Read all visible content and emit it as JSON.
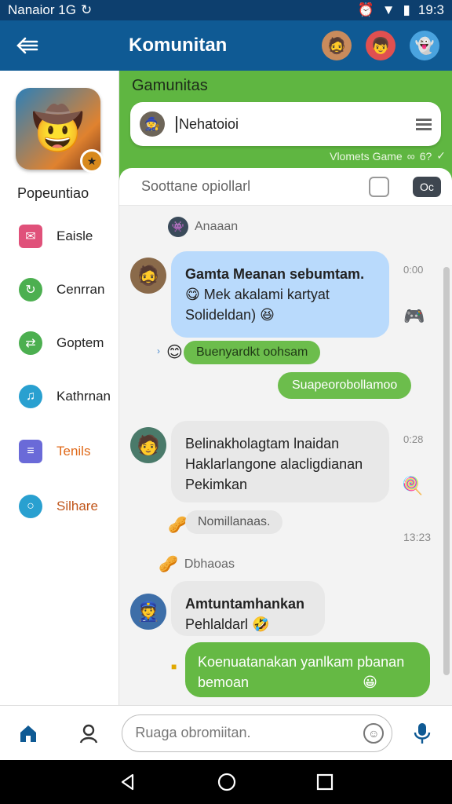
{
  "status_bar": {
    "carrier": "Nanaior 1G",
    "time": "19:3"
  },
  "app_bar": {
    "title": "Komunitan"
  },
  "sidebar": {
    "title": "Popeuntiao",
    "items": [
      {
        "label": "Eaisle",
        "icon": "bookmark-icon",
        "color": "#e0517a"
      },
      {
        "label": "Cenrran",
        "icon": "refresh-icon",
        "color": "#4caf50"
      },
      {
        "label": "Goptem",
        "icon": "sync-icon",
        "color": "#4caf50"
      },
      {
        "label": "Kathrnan",
        "icon": "music-icon",
        "color": "#29a0d0"
      },
      {
        "label": "Tenils",
        "icon": "list-icon",
        "color": "#6a6ad8",
        "label_color": "#e06a1a"
      },
      {
        "label": "Silhare",
        "icon": "chat-icon",
        "color": "#29a0d0",
        "label_color": "#c0551a"
      }
    ]
  },
  "header": {
    "title": "Gamunitas",
    "search_value": "Nehatoioi",
    "status": "Vlomets Game",
    "status_count": "6?"
  },
  "filter": {
    "placeholder": "Soottane opiollarl",
    "button_label": "Oc"
  },
  "messages": {
    "sender1": "Anaaan",
    "msg1": {
      "line1": "Gamta Meanan sebumtam.",
      "line2": "Mek akalami kartyat",
      "line3": "Solideldan)",
      "time": "0:00"
    },
    "reply1": "Buenyardkt oohsam",
    "out1": "Suapeorobollamoo",
    "msg2": {
      "line1": "Belinakholagtam lnaidan",
      "line2": "Haklarlangone alacligdianan",
      "line3": "Pekimkan",
      "time": "0:28"
    },
    "reply2": "Nomillanaas.",
    "time2": "13:23",
    "sender2": "Dbhaoas",
    "msg3": {
      "line1": "Amtuntamhankan",
      "line2": "Pehlaldarl"
    },
    "out2": {
      "line1": "Koenuatanakan yanlkam pbanan",
      "line2": "bemoan"
    }
  },
  "composer": {
    "placeholder": "Ruaga obromiitan."
  },
  "colors": {
    "brand": "#0f5a94",
    "accent_green": "#5fb641",
    "bubble_blue": "#b9dafc"
  }
}
